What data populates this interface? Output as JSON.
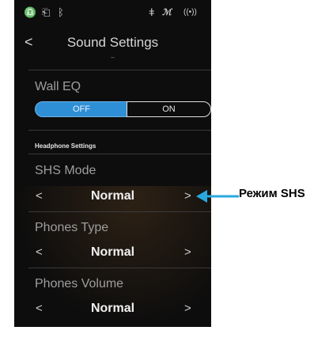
{
  "status_bar": {
    "icons": [
      "headphones-icon",
      "usb-icon",
      "bluetooth-icon",
      "mic-icon",
      "wave-icon",
      "wireless-icon"
    ],
    "glyphs": {
      "headphones": "♎",
      "usb": "⎗",
      "bluetooth": "ᛒ",
      "mic": "ǂ",
      "wave": "ℳ",
      "wireless": "((•))"
    }
  },
  "header": {
    "back": "<",
    "title": "Sound Settings",
    "subtitle_mark": "–"
  },
  "wall_eq": {
    "label": "Wall EQ",
    "off_label": "OFF",
    "on_label": "ON",
    "selected": "OFF",
    "accent_color": "#2f8fd6"
  },
  "headphone_section": {
    "heading": "Headphone Settings"
  },
  "settings": [
    {
      "label": "SHS Mode",
      "value": "Normal",
      "left": "<",
      "right": ">"
    },
    {
      "label": "Phones Type",
      "value": "Normal",
      "left": "<",
      "right": ">"
    },
    {
      "label": "Phones Volume",
      "value": "Normal",
      "left": "<",
      "right": ">"
    }
  ],
  "callout": {
    "text": "Режим SHS",
    "color": "#29a9e0"
  }
}
